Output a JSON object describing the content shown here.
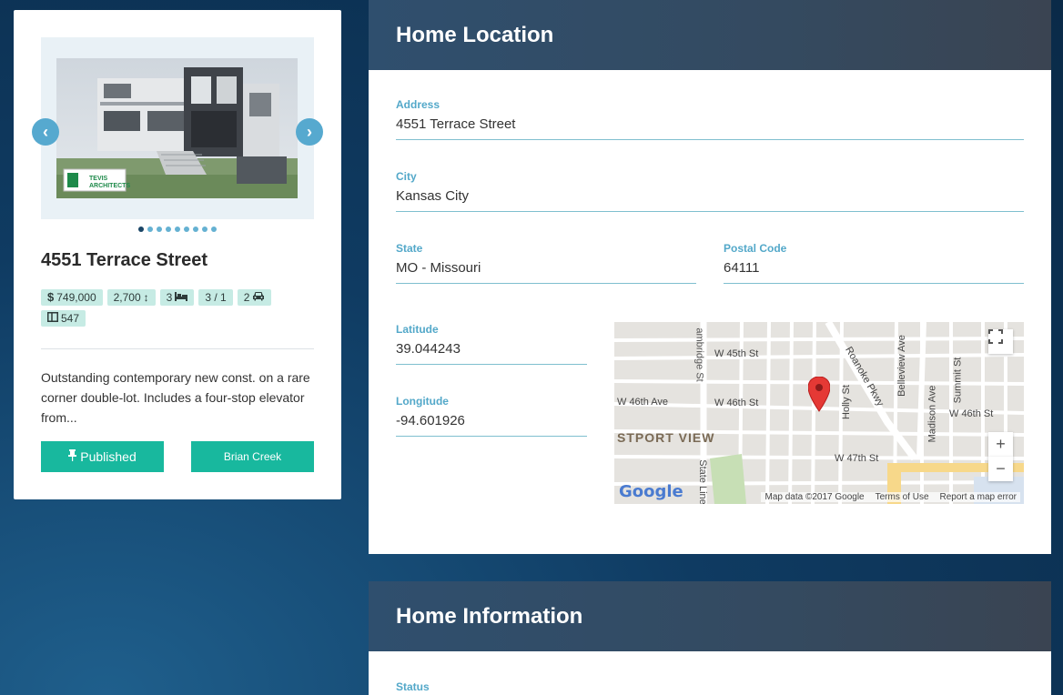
{
  "listing": {
    "address": "4551 Terrace Street",
    "price": "749,000",
    "sqft": "2,700",
    "beds": "3",
    "baths": "3 / 1",
    "garage": "2",
    "lot": "547",
    "description": "Outstanding contemporary new const. on a rare corner double-lot. Includes a four-stop elevator from...",
    "published_label": "Published",
    "agent_label": "Brian Creek",
    "photo_sign_text": "TEVIS ARCHITECTS",
    "dot_count": 9,
    "active_dot": 0
  },
  "location": {
    "header": "Home Location",
    "address_label": "Address",
    "address_value": "4551 Terrace Street",
    "city_label": "City",
    "city_value": "Kansas City",
    "state_label": "State",
    "state_value": "MO - Missouri",
    "postal_label": "Postal Code",
    "postal_value": "64111",
    "latitude_label": "Latitude",
    "latitude_value": "39.044243",
    "longitude_label": "Longitude",
    "longitude_value": "-94.601926"
  },
  "map": {
    "streets": {
      "w45": "W 45th St",
      "w46a": "W 46th Ave",
      "w46b": "W 46th St",
      "w46c": "W 46th St",
      "w47": "W 47th St",
      "cambridge": "ambridge St",
      "roanoke": "Roanoke Pkwy",
      "belleview": "Belleview Ave",
      "holly": "Holly St",
      "madison": "Madison Ave",
      "summit": "Summit St",
      "stateline": "State Line",
      "neighborhood": "STPORT VIEW"
    },
    "attribution": "Map data ©2017 Google",
    "terms": "Terms of Use",
    "report": "Report a map error",
    "logo": "Google",
    "zoom_in": "+",
    "zoom_out": "−"
  },
  "information": {
    "header": "Home Information",
    "status_label": "Status"
  }
}
